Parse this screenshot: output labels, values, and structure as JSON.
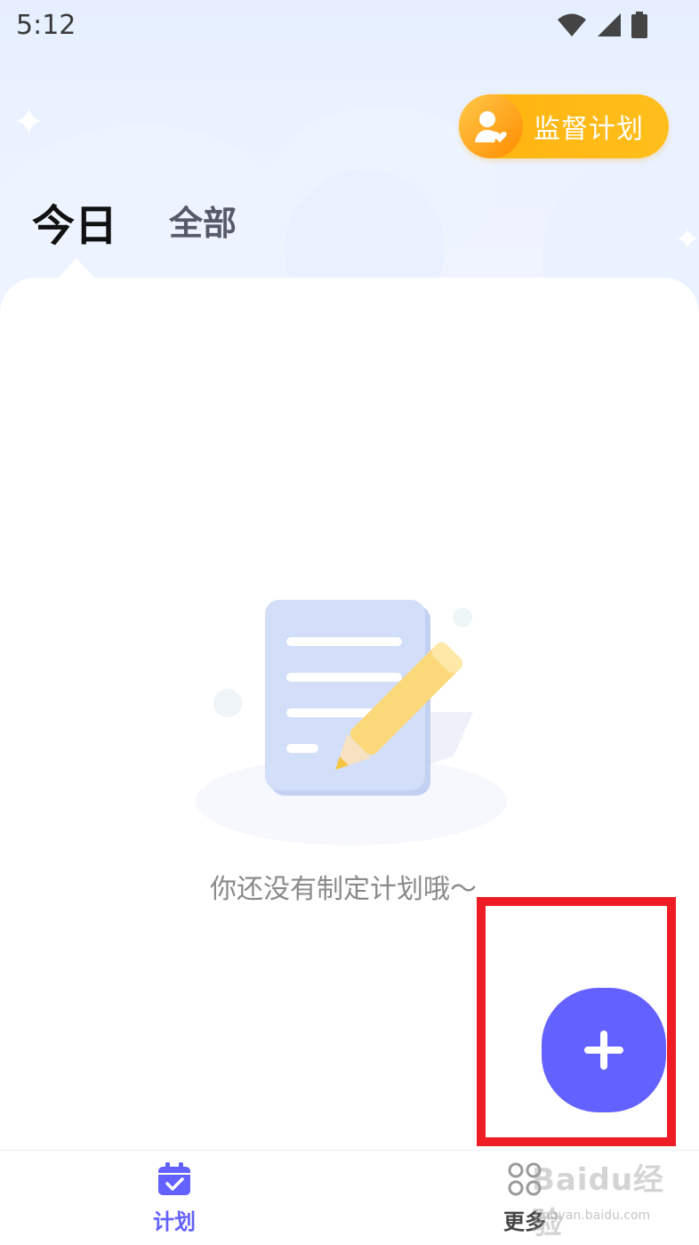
{
  "status_bar": {
    "time": "5:12",
    "icons": [
      "wifi-icon",
      "signal-icon",
      "battery-icon"
    ]
  },
  "header": {
    "supervise_button": {
      "label": "监督计划",
      "icon": "user-heart-icon"
    },
    "tabs": [
      {
        "label": "今日",
        "active": true
      },
      {
        "label": "全部",
        "active": false
      }
    ]
  },
  "empty_state": {
    "icon": "notepad-pencil-illustration",
    "message": "你还没有制定计划哦～"
  },
  "fab": {
    "icon": "plus-icon"
  },
  "bottom_nav": {
    "items": [
      {
        "label": "计划",
        "icon": "calendar-check-icon",
        "active": true
      },
      {
        "label": "更多",
        "icon": "apps-grid-icon",
        "active": false
      }
    ]
  },
  "watermark": {
    "text": "Baidu经验",
    "url": "jingyan.baidu.com"
  },
  "colors": {
    "accent": "#6361ff",
    "supervise_button": "#ffb20f",
    "highlight_box": "#ee1c25"
  }
}
